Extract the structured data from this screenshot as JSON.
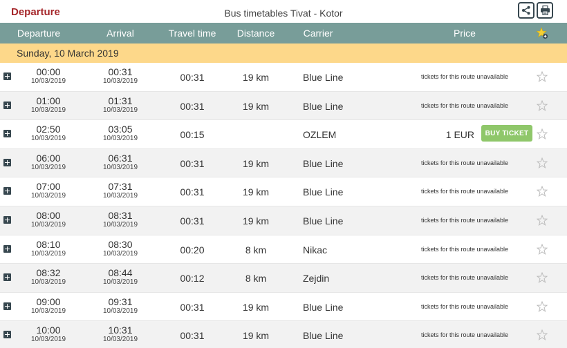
{
  "header": {
    "page_heading": "Departure",
    "title": "Bus timetables Tivat - Kotor",
    "share_icon": "share-icon",
    "print_icon": "printer-icon"
  },
  "columns": {
    "departure": "Departure",
    "arrival": "Arrival",
    "travel_time": "Travel time",
    "distance": "Distance",
    "carrier": "Carrier",
    "price": "Price",
    "favorites_icon": "star-add-icon"
  },
  "date_label": "Sunday, 10 March 2019",
  "unavailable_text": "tickets for this route unavailable",
  "buy_label": "BUY TICKET",
  "colors": {
    "header_bg": "#789d99",
    "date_band": "#fdd88a",
    "brand_red": "#a5262a",
    "buy_green": "#8fc76a"
  },
  "rows": [
    {
      "dep_time": "00:00",
      "dep_date": "10/03/2019",
      "arr_time": "00:31",
      "arr_date": "10/03/2019",
      "travel": "00:31",
      "distance": "19 km",
      "carrier": "Blue Line",
      "price": "",
      "available": false
    },
    {
      "dep_time": "01:00",
      "dep_date": "10/03/2019",
      "arr_time": "01:31",
      "arr_date": "10/03/2019",
      "travel": "00:31",
      "distance": "19 km",
      "carrier": "Blue Line",
      "price": "",
      "available": false
    },
    {
      "dep_time": "02:50",
      "dep_date": "10/03/2019",
      "arr_time": "03:05",
      "arr_date": "10/03/2019",
      "travel": "00:15",
      "distance": "",
      "carrier": "OZLEM",
      "price": "1 EUR",
      "available": true
    },
    {
      "dep_time": "06:00",
      "dep_date": "10/03/2019",
      "arr_time": "06:31",
      "arr_date": "10/03/2019",
      "travel": "00:31",
      "distance": "19 km",
      "carrier": "Blue Line",
      "price": "",
      "available": false
    },
    {
      "dep_time": "07:00",
      "dep_date": "10/03/2019",
      "arr_time": "07:31",
      "arr_date": "10/03/2019",
      "travel": "00:31",
      "distance": "19 km",
      "carrier": "Blue Line",
      "price": "",
      "available": false
    },
    {
      "dep_time": "08:00",
      "dep_date": "10/03/2019",
      "arr_time": "08:31",
      "arr_date": "10/03/2019",
      "travel": "00:31",
      "distance": "19 km",
      "carrier": "Blue Line",
      "price": "",
      "available": false
    },
    {
      "dep_time": "08:10",
      "dep_date": "10/03/2019",
      "arr_time": "08:30",
      "arr_date": "10/03/2019",
      "travel": "00:20",
      "distance": "8 km",
      "carrier": "Nikac",
      "price": "",
      "available": false
    },
    {
      "dep_time": "08:32",
      "dep_date": "10/03/2019",
      "arr_time": "08:44",
      "arr_date": "10/03/2019",
      "travel": "00:12",
      "distance": "8 km",
      "carrier": "Zejdin",
      "price": "",
      "available": false
    },
    {
      "dep_time": "09:00",
      "dep_date": "10/03/2019",
      "arr_time": "09:31",
      "arr_date": "10/03/2019",
      "travel": "00:31",
      "distance": "19 km",
      "carrier": "Blue Line",
      "price": "",
      "available": false
    },
    {
      "dep_time": "10:00",
      "dep_date": "10/03/2019",
      "arr_time": "10:31",
      "arr_date": "10/03/2019",
      "travel": "00:31",
      "distance": "19 km",
      "carrier": "Blue Line",
      "price": "",
      "available": false
    }
  ]
}
